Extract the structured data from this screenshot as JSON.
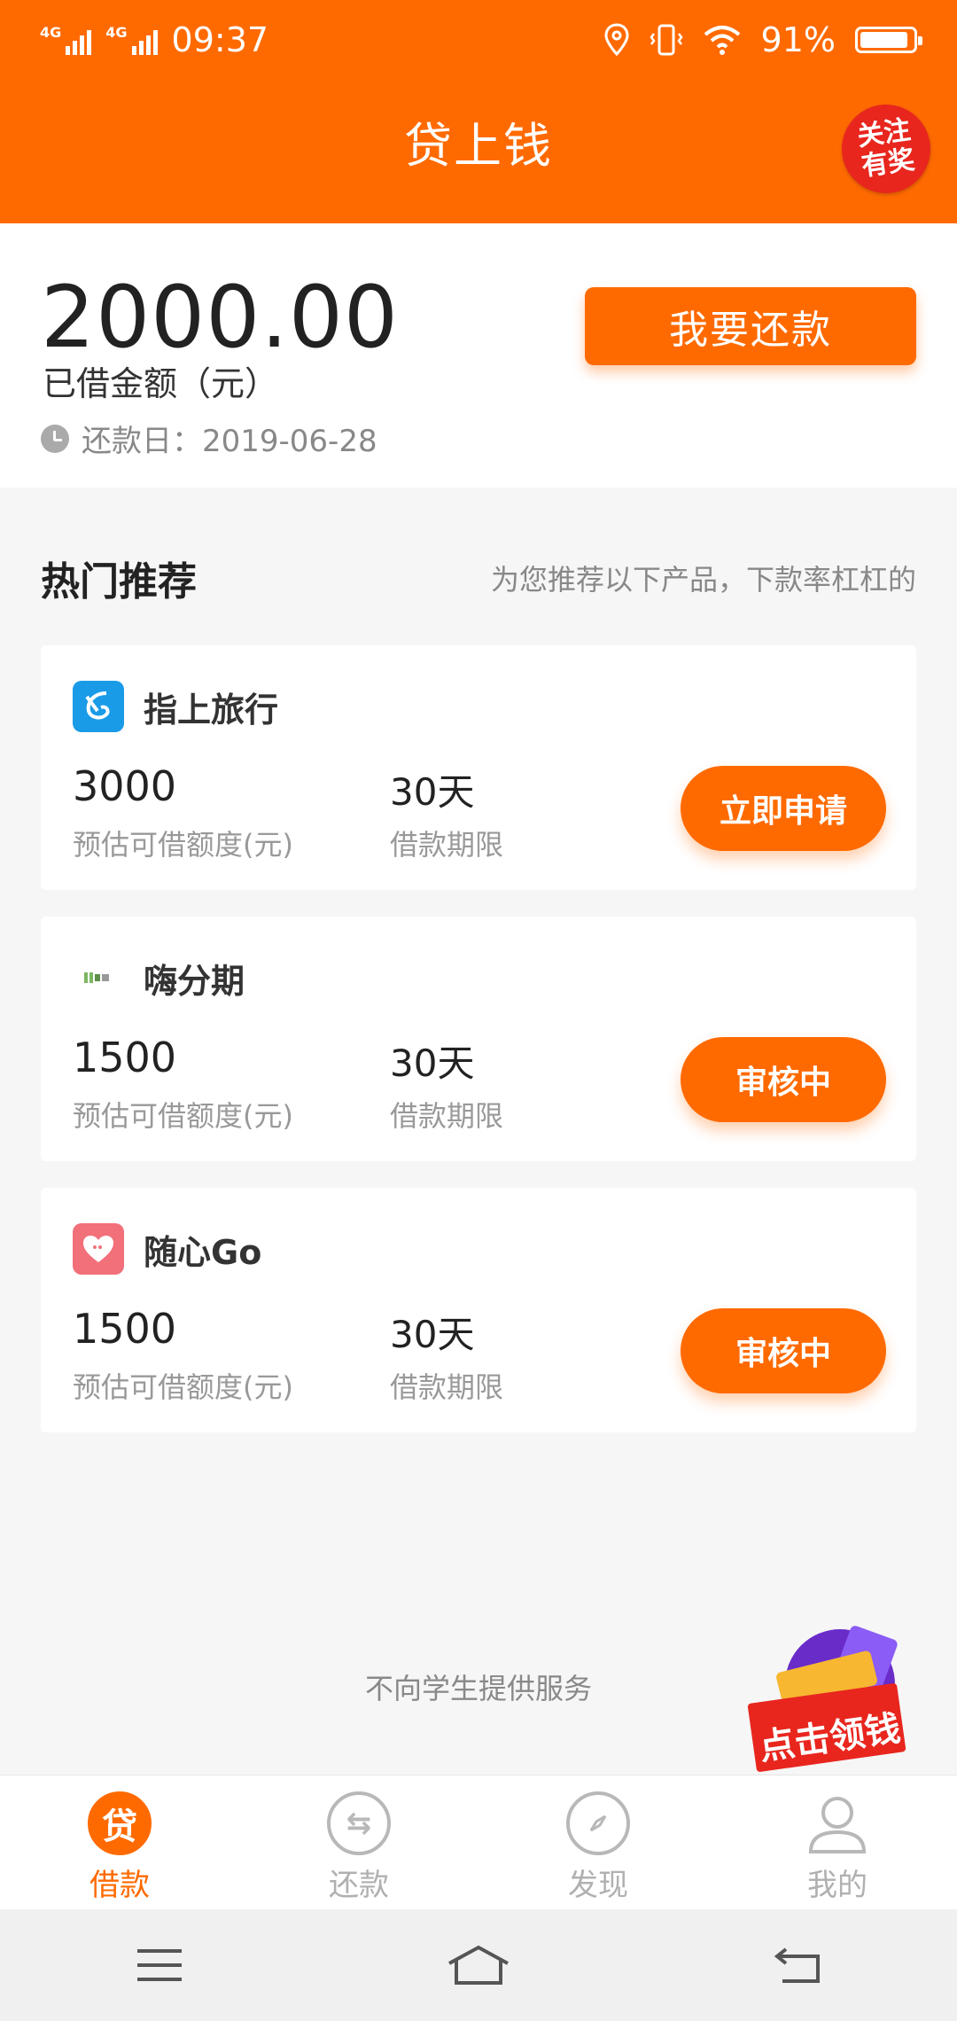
{
  "status_bar": {
    "network1": "4G",
    "network2": "4G",
    "time": "09:37",
    "battery": "91%",
    "battery_level": 0.91
  },
  "header": {
    "title": "贷上钱",
    "promo_badge": "关注有奖"
  },
  "loan": {
    "amount": "2000.00",
    "amount_label": "已借金额（元）",
    "due_date": "还款日：2019-06-28",
    "repay_button": "我要还款"
  },
  "recommend": {
    "title": "热门推荐",
    "subtitle": "为您推荐以下产品，下款率杠杠的",
    "products": [
      {
        "name": "指上旅行",
        "amount": "3000",
        "amount_label": "预估可借额度(元)",
        "term": "30天",
        "term_label": "借款期限",
        "button": "立即申请",
        "logo_color": "#1a9be8"
      },
      {
        "name": "嗨分期",
        "amount": "1500",
        "amount_label": "预估可借额度(元)",
        "term": "30天",
        "term_label": "借款期限",
        "button": "审核中",
        "logo_color": "#ffffff"
      },
      {
        "name": "随心Go",
        "amount": "1500",
        "amount_label": "预估可借额度(元)",
        "term": "30天",
        "term_label": "借款期限",
        "button": "审核中",
        "logo_color": "#f2707a"
      }
    ]
  },
  "footer_note": "不向学生提供服务",
  "gift": {
    "label": "点击领钱"
  },
  "tabs": [
    {
      "label": "借款",
      "icon": "loan-icon",
      "glyph": "贷",
      "active": true
    },
    {
      "label": "还款",
      "icon": "repay-icon",
      "glyph": "⇆",
      "active": false
    },
    {
      "label": "发现",
      "icon": "compass-icon",
      "glyph": "",
      "active": false
    },
    {
      "label": "我的",
      "icon": "user-icon",
      "glyph": "",
      "active": false
    }
  ],
  "colors": {
    "accent": "#ff6a00"
  }
}
